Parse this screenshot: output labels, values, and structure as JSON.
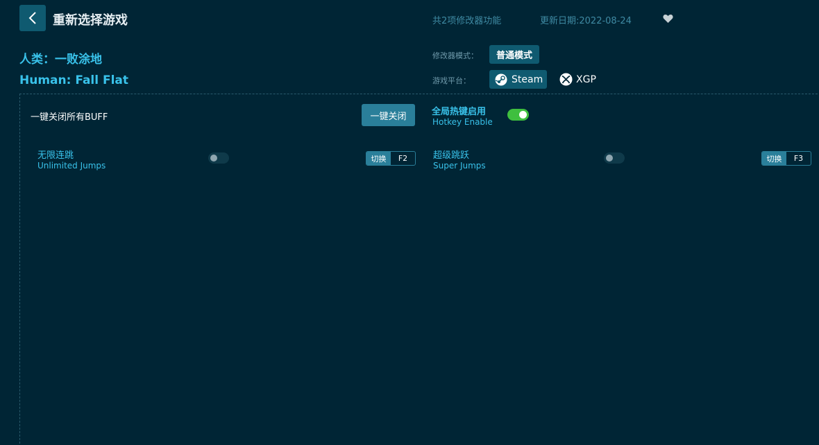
{
  "header": {
    "title": "重新选择游戏",
    "feature_count": "共2项修改器功能",
    "update_date": "更新日期:2022-08-24"
  },
  "game": {
    "name_cn": "人类：一败涂地",
    "name_en": "Human: Fall Flat"
  },
  "mode": {
    "label": "修改器模式：",
    "value": "普通模式"
  },
  "platform": {
    "label": "游戏平台：",
    "options": [
      {
        "label": "Steam",
        "selected": true,
        "icon": "steam-icon"
      },
      {
        "label": "XGP",
        "selected": false,
        "icon": "xbox-icon"
      }
    ]
  },
  "controls": {
    "close_all_label": "一键关闭所有BUFF",
    "close_all_button": "一键关闭",
    "hotkey_title": "全局热键启用",
    "hotkey_subtitle": "Hotkey Enable",
    "hotkey_enabled": true
  },
  "cheats": [
    {
      "name_cn": "无限连跳",
      "name_en": "Unlimited Jumps",
      "enabled": false,
      "action": "切换",
      "key": "F2"
    },
    {
      "name_cn": "超级跳跃",
      "name_en": "Super Jumps",
      "enabled": false,
      "action": "切换",
      "key": "F3"
    }
  ],
  "colors": {
    "background": "#002535",
    "accent": "#39c2ea",
    "button": "#0f5a70",
    "toggle_on": "#3fbf3f"
  }
}
